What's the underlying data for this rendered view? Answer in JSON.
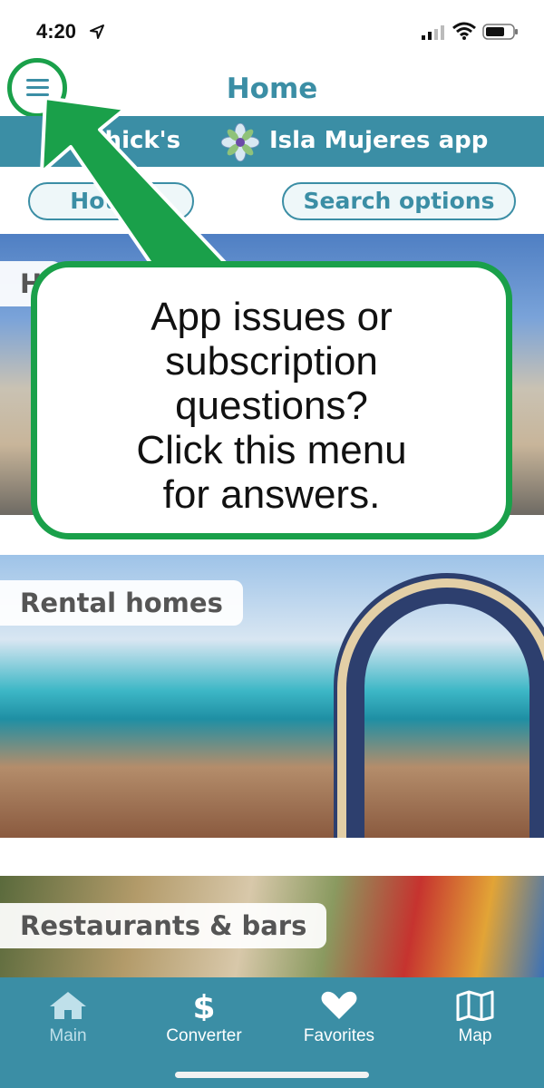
{
  "status_bar": {
    "time": "4:20"
  },
  "header": {
    "title": "Home",
    "menu_icon": "hamburger-menu-icon"
  },
  "banner": {
    "text_left": "opChick's",
    "text_right": "Isla Mujeres app",
    "flower_icon": "flower-logo-icon"
  },
  "pills": {
    "hotels": "Hotels",
    "search_options": "Search options"
  },
  "cards": [
    {
      "label": "Hotels",
      "visible_label": "H"
    },
    {
      "label": "Rental homes"
    },
    {
      "label": "Restaurants & bars"
    }
  ],
  "callout": {
    "text": "App issues or\nsubscription\nquestions?\nClick this menu\nfor answers."
  },
  "tab_bar": {
    "items": [
      {
        "label": "Main",
        "icon": "home-icon"
      },
      {
        "label": "Converter",
        "icon": "dollar-icon"
      },
      {
        "label": "Favorites",
        "icon": "heart-icon"
      },
      {
        "label": "Map",
        "icon": "map-icon"
      }
    ]
  },
  "colors": {
    "accent": "#3b8ea5",
    "callout_green": "#1aa04a",
    "label_gray": "#555555"
  }
}
